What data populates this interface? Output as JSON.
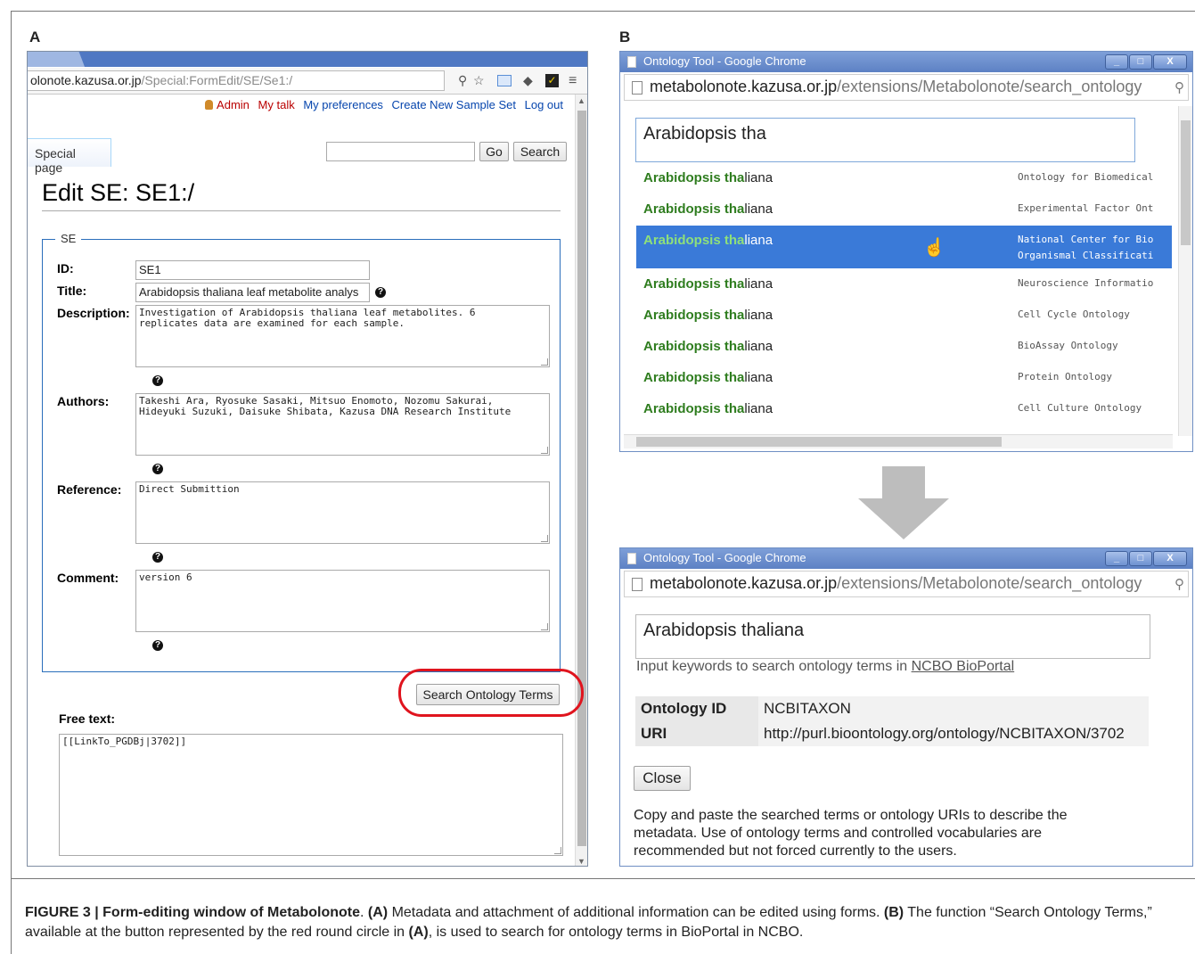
{
  "panel_labels": {
    "a": "A",
    "b": "B"
  },
  "panel_a": {
    "url_host": "olonote.kazusa.or.jp",
    "url_path": "/Special:FormEdit/SE/Se1:/",
    "user_links": {
      "admin": "Admin",
      "talk": "My talk",
      "prefs": "My preferences",
      "new_set": "Create New Sample Set",
      "logout": "Log out"
    },
    "special_tab": "Special page",
    "go_button": "Go",
    "search_button": "Search",
    "page_title": "Edit SE: SE1:/",
    "legend": "SE",
    "fields": {
      "id_label": "ID:",
      "id_value": "SE1",
      "title_label": "Title:",
      "title_value": "Arabidopsis thaliana leaf metabolite analys",
      "desc_label": "Description:",
      "desc_value": "Investigation of Arabidopsis thaliana leaf metabolites. 6\nreplicates data are examined for each sample.",
      "authors_label": "Authors:",
      "authors_value": "Takeshi Ara, Ryosuke Sasaki, Mitsuo Enomoto, Nozomu Sakurai,\nHideyuki Suzuki, Daisuke Shibata, Kazusa DNA Research Institute",
      "reference_label": "Reference:",
      "reference_value": "Direct Submittion",
      "comment_label": "Comment:",
      "comment_value": "version 6"
    },
    "help_glyph": "?",
    "search_ontology_button": "Search Ontology Terms",
    "free_text_label": "Free text:",
    "free_text_value": "[[LinkTo_PGDBj|3702]]"
  },
  "panel_b": {
    "window_title": "Ontology Tool - Google Chrome",
    "url_host": "metabolonote.kazusa.or.jp",
    "url_path": "/extensions/Metabolonote/search_ontology",
    "window_buttons": [
      "_",
      "□",
      "X"
    ],
    "search_query": "Arabidopsis tha",
    "suggestion_match": "Arabidopsis tha",
    "suggestion_rest": "liana",
    "suggestions": [
      {
        "ontology": "Ontology for Biomedical"
      },
      {
        "ontology": "Experimental Factor Ont"
      },
      {
        "ontology": "National Center for Bio\nOrganismal Classificati"
      },
      {
        "ontology": "Neuroscience Informatio"
      },
      {
        "ontology": "Cell Cycle Ontology"
      },
      {
        "ontology": "BioAssay Ontology"
      },
      {
        "ontology": "Protein Ontology"
      },
      {
        "ontology": "Cell Culture Ontology"
      }
    ],
    "result_query": "Arabidopsis thaliana",
    "hint_text": "Input keywords to search ontology terms in ",
    "hint_link": "NCBO BioPortal",
    "ontology_id_label": "Ontology ID",
    "ontology_id_value": "NCBITAXON",
    "uri_label": "URI",
    "uri_value": "http://purl.bioontology.org/ontology/NCBITAXON/3702",
    "close_button": "Close",
    "note": "Copy and paste the searched terms or ontology URIs to describe the metadata. Use of ontology terms and controlled vocabularies are recommended but not forced currently to the users."
  },
  "caption": {
    "figure_label": "FIGURE 3 | Form-editing window of Metabolonote",
    "a_ref": "(A)",
    "a_text": " Metadata and attachment of additional information can be edited using forms. ",
    "b_ref": "(B)",
    "b_text": " The function “Search Ontology Terms,” available at the button represented by the red round circle in ",
    "a_ref2": "(A)",
    "end_text": ", is used to search for ontology terms in BioPortal in NCBO."
  },
  "colors": {
    "accent": "#3a7ad8",
    "match_green": "#2f7d1f",
    "circle_red": "#e0141e",
    "title_bar": "#5d81c4"
  }
}
